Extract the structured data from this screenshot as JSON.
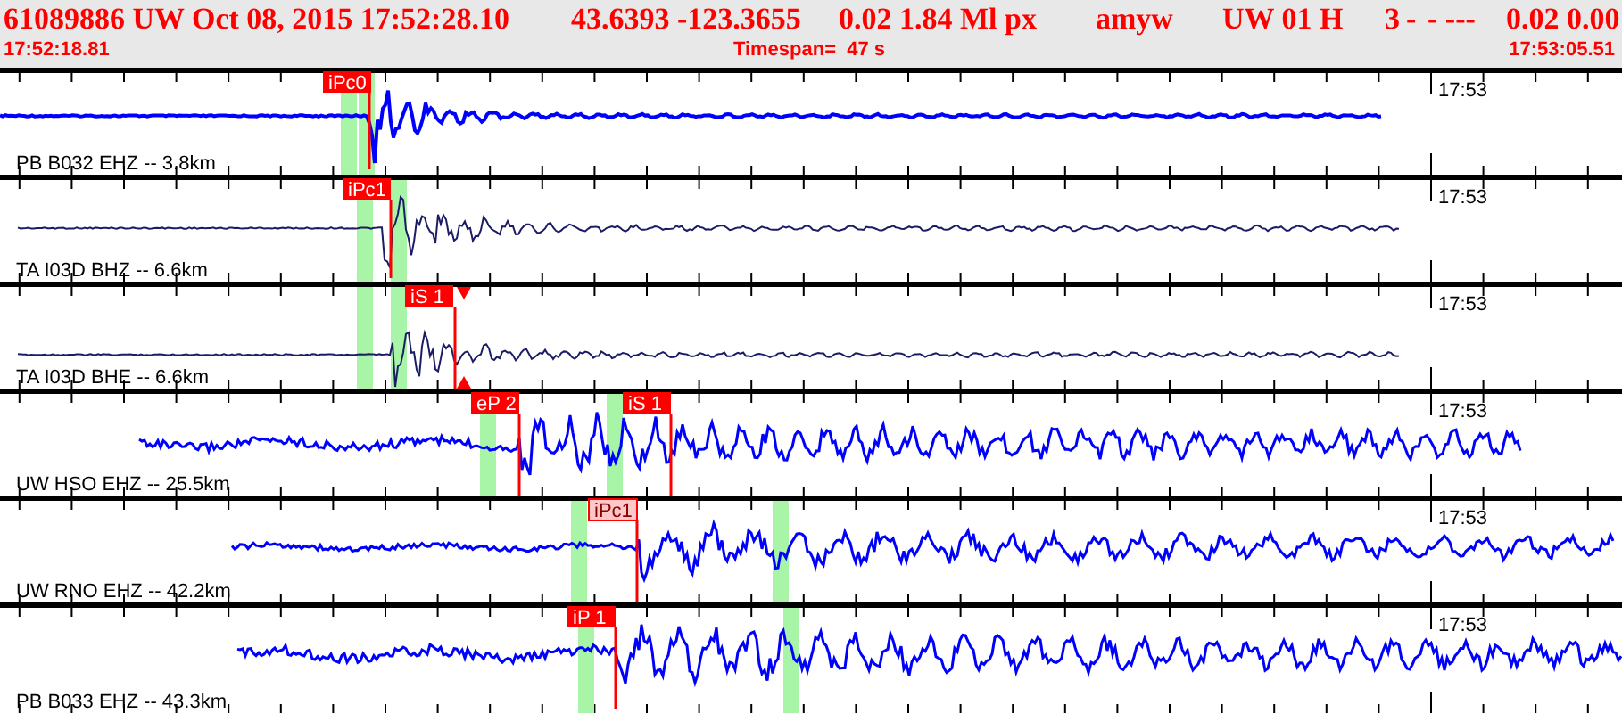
{
  "header": {
    "fields": [
      "61089886 UW Oct 08, 2015 17:52:28.10",
      "43.6393 -123.3655",
      "0.02 1.84 Ml px",
      "amyw",
      "UW 01 H",
      "3",
      "-",
      "- ---",
      "0.02 0.00"
    ],
    "start_time": "17:52:18.81",
    "timespan": "Timespan=  47 s",
    "end_time": "17:53:05.51"
  },
  "traces": [
    {
      "label": "PB B032 EHZ -- 3.8km",
      "time_label": "17:53",
      "color": "#0000ff",
      "picks": [
        {
          "label": "iPc0",
          "kind": "filled"
        }
      ]
    },
    {
      "label": "TA I03D BHZ -- 6.6km",
      "time_label": "17:53",
      "color": "#1c1c66",
      "picks": [
        {
          "label": "iPc1",
          "kind": "filled"
        }
      ]
    },
    {
      "label": "TA I03D BHE -- 6.6km",
      "time_label": "17:53",
      "color": "#1c1c66",
      "picks": [
        {
          "label": "iS 1",
          "kind": "marked"
        }
      ]
    },
    {
      "label": "UW HSO EHZ -- 25.5km",
      "time_label": "17:53",
      "color": "#0000ff",
      "picks": [
        {
          "label": "eP 2",
          "kind": "filled"
        },
        {
          "label": "iS 1",
          "kind": "filled"
        }
      ]
    },
    {
      "label": "UW RNO EHZ -- 42.2km",
      "time_label": "17:53",
      "color": "#0000ff",
      "picks": [
        {
          "label": "iPc1",
          "kind": "pale"
        }
      ]
    },
    {
      "label": "PB B033 EHZ -- 43.3km",
      "time_label": "17:53",
      "color": "#0000ff",
      "picks": [
        {
          "label": "iP 1",
          "kind": "filled"
        }
      ]
    }
  ]
}
